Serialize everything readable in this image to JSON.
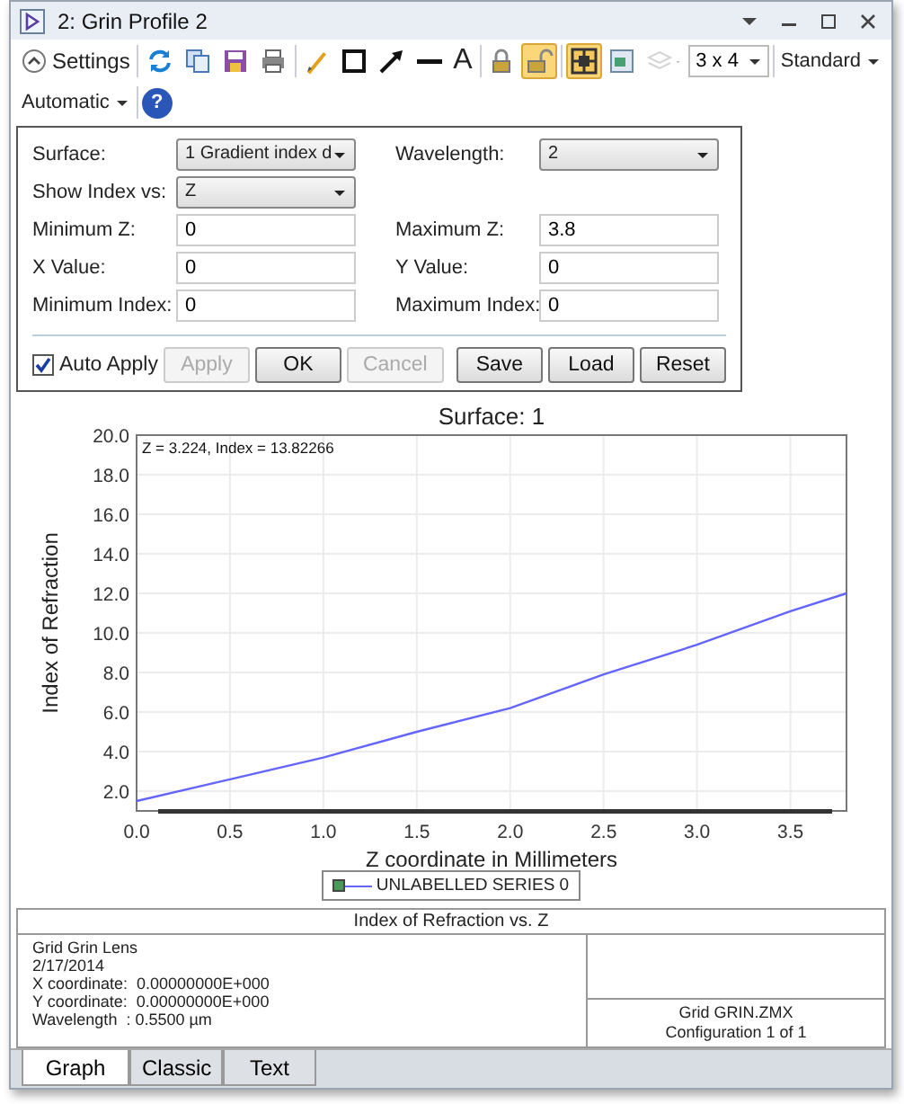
{
  "window": {
    "title": "2: Grin Profile 2"
  },
  "toolbar": {
    "settings_label": "Settings",
    "settings_expanded": true,
    "tools": [
      {
        "kind": "icon",
        "active": false,
        "disabled": false
      },
      {
        "kind": "icon",
        "active": false,
        "disabled": false
      },
      {
        "kind": "icon",
        "active": false,
        "disabled": false
      },
      {
        "kind": "icon",
        "active": false,
        "disabled": false
      },
      {
        "kind": "sep"
      },
      {
        "kind": "icon",
        "active": false,
        "disabled": false
      },
      {
        "kind": "icon",
        "active": false,
        "disabled": false
      },
      {
        "kind": "icon",
        "active": false,
        "disabled": false
      },
      {
        "kind": "icon",
        "active": false,
        "disabled": false
      },
      {
        "kind": "glyph",
        "label": "A",
        "active": false,
        "disabled": false
      },
      {
        "kind": "sep"
      },
      {
        "kind": "icon",
        "active": false,
        "disabled": false
      },
      {
        "kind": "icon",
        "active": true,
        "disabled": false
      },
      {
        "kind": "sep"
      },
      {
        "kind": "icon",
        "active": true,
        "disabled": false
      },
      {
        "kind": "icon",
        "active": false,
        "disabled": false
      },
      {
        "kind": "icon",
        "active": false,
        "disabled": true
      }
    ],
    "layout_dropdown": "3 x 4",
    "standard_menu": "Standard",
    "automatic_menu": "Automatic",
    "help": "?"
  },
  "settings": {
    "rows": [
      {
        "cells": [
          {
            "kind": "select",
            "label": "Surface:",
            "value": "1 Gradient index d"
          },
          {
            "kind": "select",
            "label": "Wavelength:",
            "value": "2"
          }
        ]
      },
      {
        "cells": [
          {
            "kind": "select",
            "label": "Show Index vs:",
            "value": "Z"
          }
        ]
      },
      {
        "cells": [
          {
            "kind": "input",
            "label": "Minimum Z:",
            "value": "0"
          },
          {
            "kind": "input",
            "label": "Maximum Z:",
            "value": "3.8"
          }
        ]
      },
      {
        "cells": [
          {
            "kind": "input",
            "label": "X Value:",
            "value": "0"
          },
          {
            "kind": "input",
            "label": "Y Value:",
            "value": "0"
          }
        ]
      },
      {
        "cells": [
          {
            "kind": "input",
            "label": "Minimum Index:",
            "value": "0"
          },
          {
            "kind": "input",
            "label": "Maximum Index:",
            "value": "0"
          }
        ]
      }
    ],
    "auto_apply": {
      "label": "Auto Apply",
      "checked": true
    },
    "action_buttons": [
      {
        "label": "Apply",
        "disabled": true
      },
      {
        "label": "OK",
        "disabled": false
      },
      {
        "label": "Cancel",
        "disabled": true
      }
    ],
    "file_buttons": [
      {
        "label": "Save",
        "disabled": false
      },
      {
        "label": "Load",
        "disabled": false
      },
      {
        "label": "Reset",
        "disabled": false
      }
    ]
  },
  "chart_data": {
    "type": "line",
    "title": "Surface: 1",
    "xlabel": "Z coordinate in Millimeters",
    "ylabel": "Index of Refraction",
    "x": [
      0,
      0.5,
      1.0,
      1.5,
      2.0,
      2.5,
      3.0,
      3.5,
      3.8
    ],
    "series": [
      {
        "name": "UNLABELLED SERIES 0",
        "color": "#6464ff",
        "values": [
          1.5,
          2.6,
          3.7,
          5.0,
          6.2,
          7.9,
          9.4,
          11.1,
          12.0
        ]
      }
    ],
    "xlim": [
      0,
      3.8
    ],
    "ylim": [
      1,
      20
    ],
    "grid": true,
    "xticks": [
      {
        "value": 0,
        "label": "0.0"
      },
      {
        "value": 0.5,
        "label": "0.5"
      },
      {
        "value": 1,
        "label": "1.0"
      },
      {
        "value": 1.5,
        "label": "1.5"
      },
      {
        "value": 2,
        "label": "2.0"
      },
      {
        "value": 2.5,
        "label": "2.5"
      },
      {
        "value": 3,
        "label": "3.0"
      },
      {
        "value": 3.5,
        "label": "3.5"
      }
    ],
    "yticks": [
      {
        "value": 2,
        "label": "2.0"
      },
      {
        "value": 4,
        "label": "4.0"
      },
      {
        "value": 6,
        "label": "6.0"
      },
      {
        "value": 8,
        "label": "8.0"
      },
      {
        "value": 10,
        "label": "10.0"
      },
      {
        "value": 12,
        "label": "12.0"
      },
      {
        "value": 14,
        "label": "14.0"
      },
      {
        "value": 16,
        "label": "16.0"
      },
      {
        "value": 18,
        "label": "18.0"
      },
      {
        "value": 20,
        "label": "20.0"
      }
    ],
    "annotations": [
      {
        "text": "Z = 3.224, Index = 13.82266"
      }
    ]
  },
  "footer": {
    "title": "Index of Refraction vs. Z",
    "lines": [
      "Grid Grin Lens",
      "2/17/2014",
      "X coordinate:  0.00000000E+000",
      "Y coordinate:  0.00000000E+000",
      "Wavelength  : 0.5500 µm"
    ],
    "file": "Grid GRIN.ZMX",
    "configuration": "Configuration 1 of 1"
  },
  "tabs": [
    {
      "label": "Graph",
      "selected": true
    },
    {
      "label": "Classic",
      "selected": false
    },
    {
      "label": "Text",
      "selected": false
    }
  ]
}
